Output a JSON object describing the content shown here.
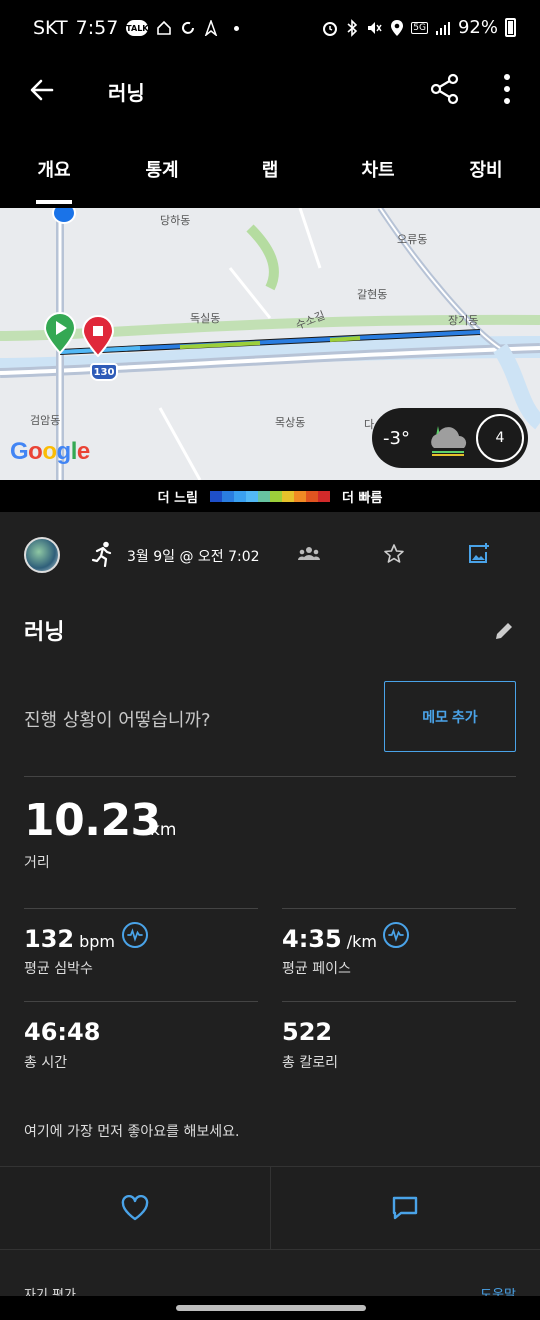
{
  "status_bar": {
    "carrier": "SKT",
    "time": "7:57",
    "talk_badge": "TALK",
    "network": "5G",
    "battery": "92%"
  },
  "header": {
    "title": "러닝"
  },
  "tabs": [
    {
      "label": "개요",
      "active": true
    },
    {
      "label": "통계",
      "active": false
    },
    {
      "label": "랩",
      "active": false
    },
    {
      "label": "차트",
      "active": false
    },
    {
      "label": "장비",
      "active": false
    }
  ],
  "map": {
    "labels": [
      "당하동",
      "오류동",
      "갈현동",
      "독실동",
      "수소길",
      "장기동",
      "검암동",
      "목상동",
      "다"
    ],
    "route_badge": "130",
    "weather_temp": "-3°",
    "wind": "4",
    "google_logo": "Google"
  },
  "speed_legend": {
    "slow_label": "더 느림",
    "fast_label": "더 빠름",
    "colors": [
      "#1e4fc9",
      "#2a7de0",
      "#3aa0f0",
      "#52b8f5",
      "#67c3a0",
      "#9ccf3a",
      "#e5c12b",
      "#f08a24",
      "#e05420",
      "#d12a2a"
    ]
  },
  "activity": {
    "date": "3월 9일 @ 오전 7:02",
    "title": "러닝",
    "prompt": "진행 상황이 어떻습니까?",
    "memo_button": "메모 추가",
    "distance": {
      "value": "10.23",
      "unit": "km",
      "label": "거리"
    },
    "avg_hr": {
      "value": "132",
      "unit": "bpm",
      "label": "평균 심박수"
    },
    "avg_pace": {
      "value": "4:35",
      "unit": "/km",
      "label": "평균 페이스"
    },
    "total_time": {
      "value": "46:48",
      "label": "총 시간"
    },
    "total_calories": {
      "value": "522",
      "label": "총 칼로리"
    },
    "kudos_text": "여기에 가장 먼저 좋아요를 해보세요."
  },
  "footer": {
    "self_eval": "자기 평가",
    "help": "도움말"
  },
  "colors": {
    "accent": "#4aa3e8",
    "background": "#202020",
    "start": "#34a853",
    "stop": "#e0283a"
  }
}
